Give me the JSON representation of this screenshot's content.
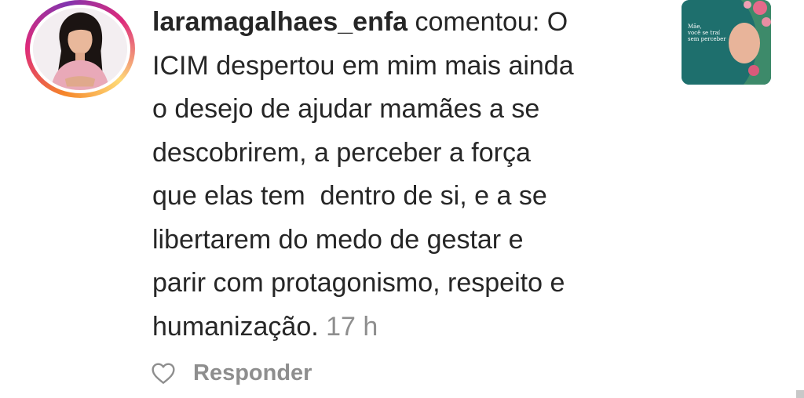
{
  "comment": {
    "username": "laramagalhaes_enfa",
    "verb": " comentou: O",
    "lines": [
      "ICIM despertou em mim mais ainda",
      "o desejo de ajudar mamães a se",
      "descobrirem, a perceber a força",
      "que elas tem  dentro de si, e a se",
      "libertarem do medo de gestar e",
      "parir com protagonismo, respeito e",
      "humanização."
    ],
    "time": "17 h"
  },
  "actions": {
    "like_icon": "heart-icon",
    "reply_label": "Responder"
  },
  "thumbnail": {
    "caption_line1": "Mãe,",
    "caption_line2": "você se traí",
    "caption_line3": "sem perceber"
  },
  "colors": {
    "text": "#262626",
    "muted": "#8e8e8e",
    "thumb_bg": "#1e6f6d"
  }
}
